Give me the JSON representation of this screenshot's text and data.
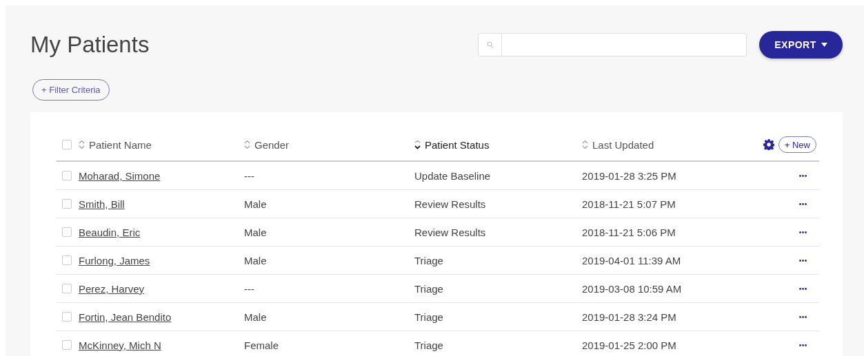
{
  "page_title": "My Patients",
  "export_button": {
    "label": "EXPORT"
  },
  "filter_button": {
    "label": "+ Filter Criteria"
  },
  "table": {
    "all_checked": false,
    "columns": [
      {
        "label": "Patient Name",
        "sorted": false
      },
      {
        "label": "Gender",
        "sorted": false
      },
      {
        "label": "Patient Status",
        "sorted": true
      },
      {
        "label": "Last Updated",
        "sorted": false
      }
    ],
    "new_button": {
      "label": "+ New"
    },
    "rows": [
      {
        "checked": false,
        "name": "Moharad, Simone",
        "gender": "---",
        "status": "Update Baseline",
        "updated": "2019-01-28 3:25 PM"
      },
      {
        "checked": false,
        "name": "Smith, Bill",
        "gender": "Male",
        "status": "Review Results",
        "updated": "2018-11-21 5:07 PM"
      },
      {
        "checked": false,
        "name": "Beaudin, Eric",
        "gender": "Male",
        "status": "Review Results",
        "updated": "2018-11-21 5:06 PM"
      },
      {
        "checked": false,
        "name": "Furlong, James",
        "gender": "Male",
        "status": "Triage",
        "updated": "2019-04-01 11:39 AM"
      },
      {
        "checked": false,
        "name": "Perez, Harvey",
        "gender": "---",
        "status": "Triage",
        "updated": "2019-03-08 10:59 AM"
      },
      {
        "checked": false,
        "name": "Fortin, Jean Bendito",
        "gender": "Male",
        "status": "Triage",
        "updated": "2019-01-28 3:24 PM"
      },
      {
        "checked": false,
        "name": "McKinney, Mich N",
        "gender": "Female",
        "status": "Triage",
        "updated": "2019-01-25 2:00 PM"
      }
    ]
  }
}
